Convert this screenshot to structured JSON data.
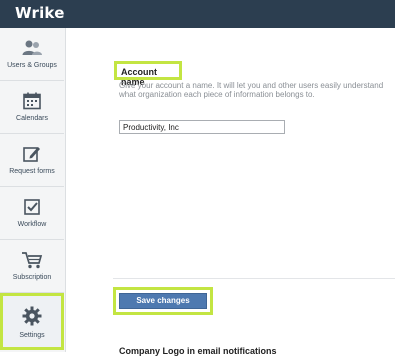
{
  "app": {
    "logo_text": "Wrike"
  },
  "colors": {
    "topbar": "#2c3e50",
    "highlight": "#c3e542",
    "button": "#4e79b0"
  },
  "sidebar": {
    "items": [
      {
        "label": "Users & Groups",
        "icon": "users-icon"
      },
      {
        "label": "Calendars",
        "icon": "calendar-icon"
      },
      {
        "label": "Request forms",
        "icon": "edit-form-icon"
      },
      {
        "label": "Workflow",
        "icon": "checkbox-icon"
      },
      {
        "label": "Subscription",
        "icon": "cart-icon"
      },
      {
        "label": "Settings",
        "icon": "gear-icon",
        "active": true
      }
    ]
  },
  "main": {
    "account_name": {
      "label": "Account name",
      "description": "Give your account a name. It will let you and other users easily understand what organization each piece of information belongs to.",
      "value": "Productivity, Inc"
    },
    "save_label": "Save changes",
    "next_section_heading": "Company Logo in email notifications"
  }
}
